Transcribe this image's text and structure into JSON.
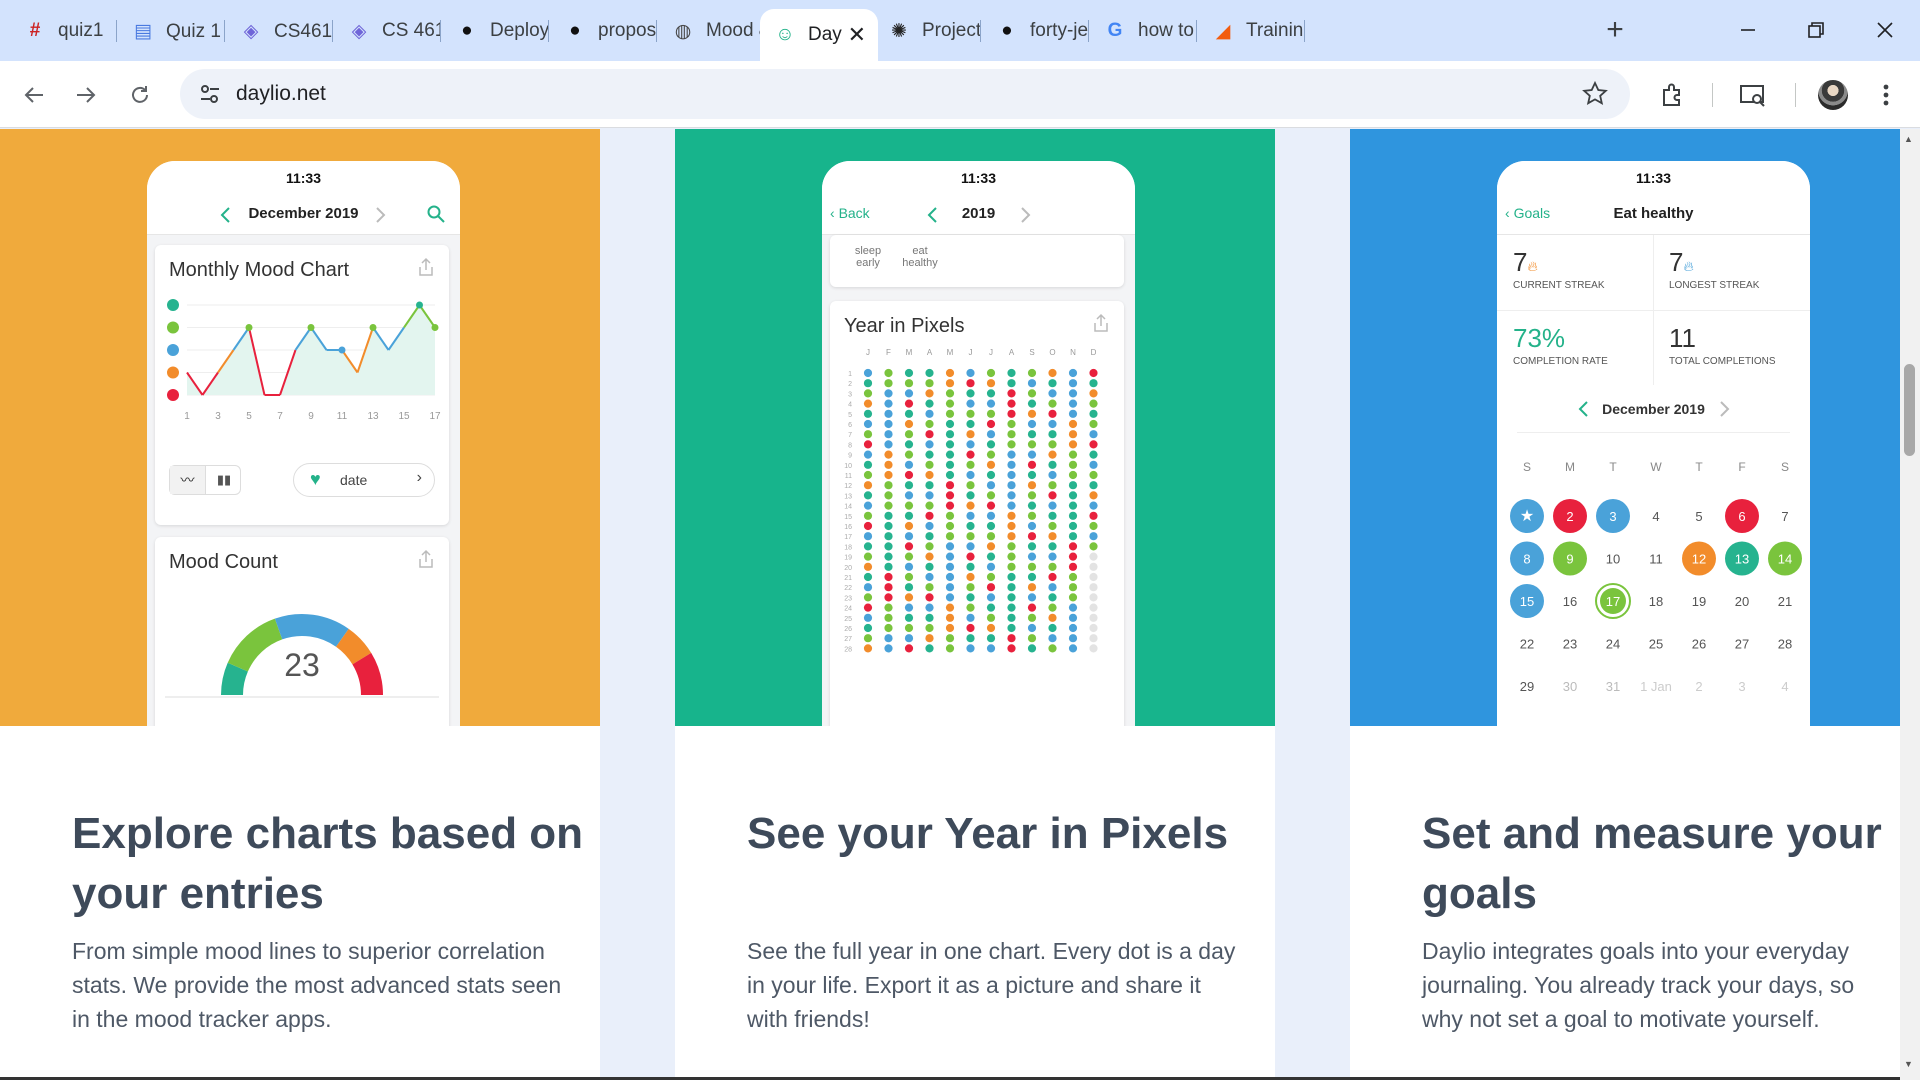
{
  "browser": {
    "tabs": [
      {
        "title": "quiz1",
        "icon": "quiz-app-icon"
      },
      {
        "title": "Quiz 1 ∶",
        "icon": "docs-icon"
      },
      {
        "title": "CS461 ∶",
        "icon": "cube-icon"
      },
      {
        "title": "CS 461",
        "icon": "cube-icon"
      },
      {
        "title": "Deploy",
        "icon": "github-icon"
      },
      {
        "title": "propos",
        "icon": "github-icon"
      },
      {
        "title": "Mood &",
        "icon": "globe-icon"
      },
      {
        "title": "Day",
        "icon": "daylio-icon",
        "active": true
      },
      {
        "title": "Project",
        "icon": "openai-icon"
      },
      {
        "title": "forty-je",
        "icon": "github-icon"
      },
      {
        "title": "how to",
        "icon": "google-icon"
      },
      {
        "title": "Training",
        "icon": "training-icon"
      }
    ],
    "url": "daylio.net"
  },
  "colors": {
    "panel1": "#f0aa3c",
    "panel2": "#17b48c",
    "panel3": "#2f95de",
    "mood_rad": "#26b38f",
    "mood_good": "#7ac43d",
    "mood_meh": "#4aa2d9",
    "mood_bad": "#f28c2b",
    "mood_awful": "#e8213d",
    "accent": "#24b28a"
  },
  "panels": [
    {
      "headline": "Explore charts based on your entries",
      "description": "From simple mood lines to superior correlation stats. We provide the most advanced stats seen in the mood tracker apps.",
      "phone": {
        "time": "11:33",
        "nav_title": "December 2019",
        "card1_title": "Monthly Mood Chart",
        "x_ticks": [
          "1",
          "3",
          "5",
          "7",
          "9",
          "11",
          "13",
          "15",
          "17"
        ],
        "date_button": "date",
        "card2_title": "Mood Count",
        "mood_count_total": "23",
        "mood_counts": [
          "3",
          "6",
          "7",
          "3",
          "4"
        ]
      }
    },
    {
      "headline": "See your Year in Pixels",
      "description": "See the full year in one chart. Every dot is a day in your life. Export it as a picture and share it with friends!",
      "phone": {
        "time": "11:33",
        "back_label": "Back",
        "nav_title": "2019",
        "goal_icons": [
          "sleep early",
          "eat healthy"
        ],
        "card_title": "Year in Pixels",
        "month_letters": [
          "J",
          "F",
          "M",
          "A",
          "M",
          "J",
          "J",
          "A",
          "S",
          "O",
          "N",
          "D"
        ]
      }
    },
    {
      "headline": "Set and measure your goals",
      "description": "Daylio integrates goals into your everyday journaling. You already track your days, so why not set a goal to motivate yourself.",
      "phone": {
        "time": "11:33",
        "back_label": "Goals",
        "nav_title": "Eat healthy",
        "current_streak": "7",
        "current_streak_label": "CURRENT STREAK",
        "longest_streak": "7",
        "longest_streak_label": "LONGEST STREAK",
        "completion_rate": "73%",
        "completion_rate_label": "COMPLETION RATE",
        "total_completions": "11",
        "total_completions_label": "TOTAL COMPLETIONS",
        "calendar_month": "December 2019",
        "weekdays": [
          "S",
          "M",
          "T",
          "W",
          "T",
          "F",
          "S"
        ],
        "days": [
          "★",
          "2",
          "3",
          "4",
          "5",
          "6",
          "7",
          "8",
          "9",
          "10",
          "11",
          "12",
          "13",
          "14",
          "15",
          "16",
          "17",
          "18",
          "19",
          "20",
          "21",
          "22",
          "23",
          "24",
          "25",
          "26",
          "27",
          "28",
          "29",
          "30",
          "31",
          "1 Jan",
          "2",
          "3",
          "4"
        ],
        "day_moods": [
          "meh",
          "awful",
          "meh",
          "",
          "",
          "awful",
          "",
          "meh",
          "good",
          "",
          "",
          "bad",
          "rad",
          "good",
          "meh",
          "",
          "good-ring",
          "",
          "",
          "",
          "",
          "",
          "",
          "",
          "",
          "",
          "",
          "",
          "",
          "",
          "",
          "",
          "",
          "",
          ""
        ]
      }
    }
  ],
  "chart_data": [
    {
      "type": "line",
      "title": "Monthly Mood Chart",
      "x": [
        1,
        2,
        3,
        4,
        5,
        6,
        7,
        8,
        9,
        10,
        11,
        12,
        13,
        14,
        15,
        16,
        17
      ],
      "y": [
        2,
        1,
        2,
        3,
        4,
        1,
        1,
        3,
        4,
        3,
        3,
        2,
        4,
        3,
        4,
        5,
        4
      ],
      "ylim": [
        1,
        5
      ],
      "y_scale_labels": [
        "awful",
        "bad",
        "meh",
        "good",
        "rad"
      ],
      "grid": true
    },
    {
      "type": "pie",
      "title": "Mood Count",
      "categories": [
        "rad",
        "good",
        "meh",
        "bad",
        "awful"
      ],
      "values": [
        3,
        6,
        7,
        3,
        4
      ]
    }
  ]
}
